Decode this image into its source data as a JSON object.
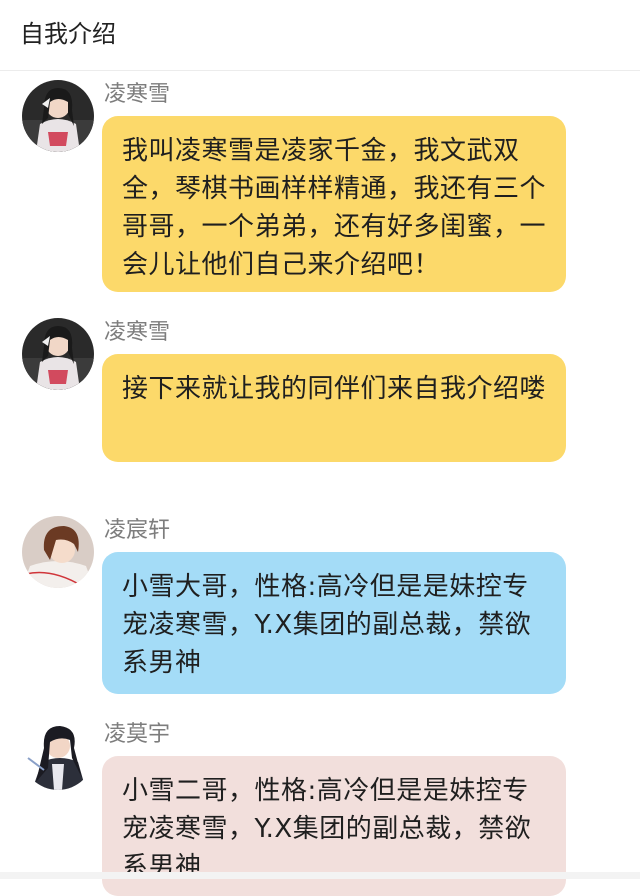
{
  "header": {
    "title": "自我介绍"
  },
  "messages": [
    {
      "sender": "凌寒雪",
      "text": "我叫凌寒雪是凌家千金，我文武双全，琴棋书画样样精通，我还有三个哥哥，一个弟弟，还有好多闺蜜，一会儿让他们自己来介绍吧！",
      "bubble_color": "#fcd96a",
      "avatar_icon": "girl-avatar-icon"
    },
    {
      "sender": "凌寒雪",
      "text": "接下来就让我的同伴们来自我介绍喽",
      "bubble_color": "#fcd96a",
      "avatar_icon": "girl-avatar-icon"
    },
    {
      "sender": "凌宸轩",
      "text": "小雪大哥，性格:高冷但是是妹控专宠凌寒雪，Y.X集团的副总裁，禁欲系男神",
      "bubble_color": "#a4dcf7",
      "avatar_icon": "boy-avatar-icon"
    },
    {
      "sender": "凌莫宇",
      "text": "小雪二哥，性格:高冷但是是妹控专宠凌寒雪，Y.X集团的副总裁，禁欲系男神",
      "bubble_color": "#f2dfdc",
      "avatar_icon": "boy-avatar-icon"
    }
  ]
}
